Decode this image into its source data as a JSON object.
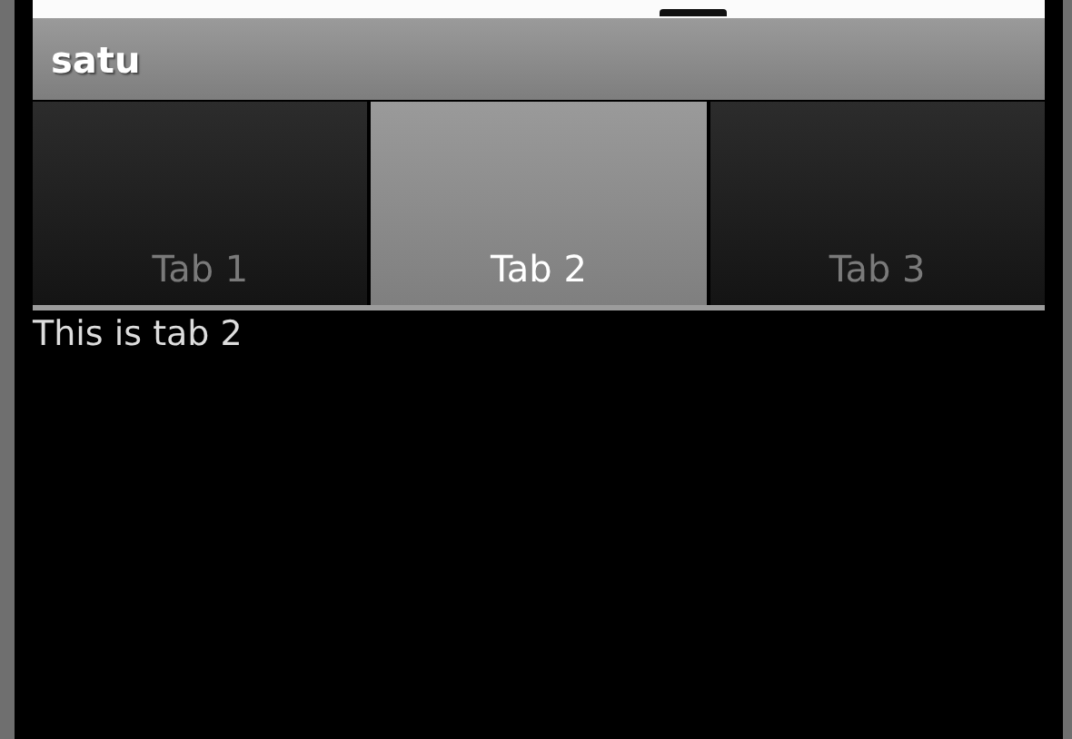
{
  "title_bar": {
    "title": "satu"
  },
  "tabs": [
    {
      "label": "Tab 1",
      "selected": false
    },
    {
      "label": "Tab 2",
      "selected": true
    },
    {
      "label": "Tab 3",
      "selected": false
    }
  ],
  "content": {
    "text": "This is tab 2"
  }
}
